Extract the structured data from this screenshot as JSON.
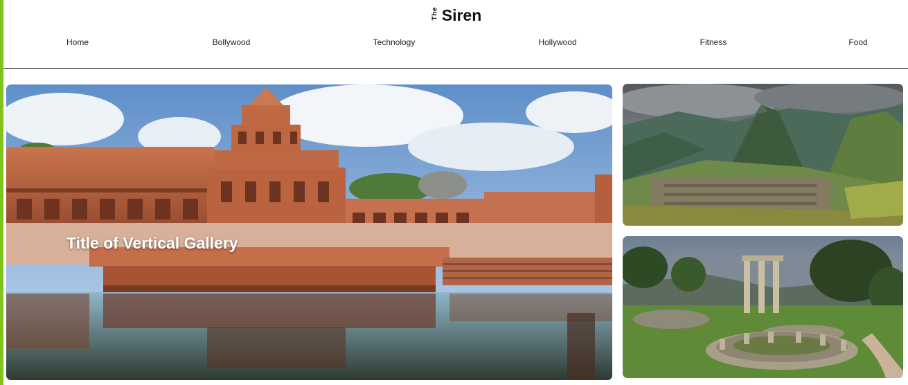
{
  "header": {
    "logo_small": "The",
    "logo_main": "Siren"
  },
  "nav": {
    "items": [
      {
        "label": "Home"
      },
      {
        "label": "Bollywood"
      },
      {
        "label": "Technology"
      },
      {
        "label": "Hollywood"
      },
      {
        "label": "Fitness"
      },
      {
        "label": "Food"
      }
    ]
  },
  "gallery": {
    "title": "Title of Vertical Gallery"
  },
  "theme": {
    "accent": "#7fc31c",
    "divider": "#111111"
  }
}
